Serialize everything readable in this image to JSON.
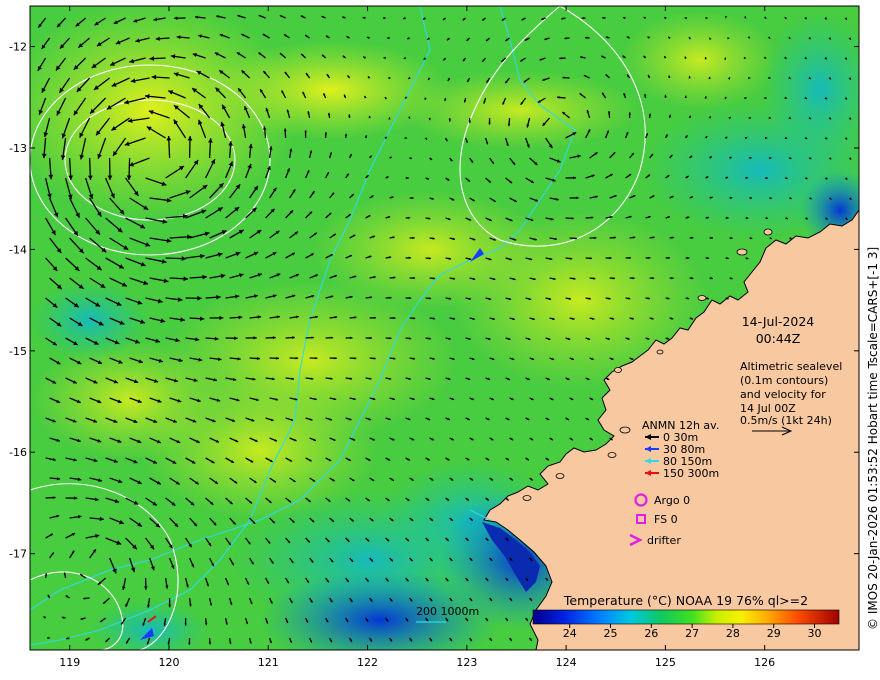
{
  "map": {
    "lon_range": [
      118.6,
      126.95
    ],
    "lat_range": [
      -17.95,
      -11.6
    ],
    "lon_ticks": [
      "119",
      "120",
      "121",
      "122",
      "123",
      "124",
      "125",
      "126"
    ],
    "lat_ticks": [
      "-12",
      "-13",
      "-14",
      "-15",
      "-16",
      "-17"
    ],
    "colors": {
      "land": "#f8c8a0",
      "coast": "#000000",
      "sealevel_contour": "#ffffff",
      "isobath": "#30d8e8"
    }
  },
  "annotations": {
    "date": "14-Jul-2024",
    "time": "00:44Z",
    "alt_lines": [
      "Altimetric sealevel",
      "(0.1m contours)",
      "and velocity for",
      "14 Jul 00Z",
      "0.5m/s (1kt 24h)"
    ],
    "side_text": "© IMOS 20-Jan-2026 01:53:52 Hobart time Tscale=CARS+[-1 3]"
  },
  "legend": {
    "title": "ANMN 12h av.",
    "items": [
      {
        "label": "0 30m",
        "color": "#000000"
      },
      {
        "label": "30 80m",
        "color": "#1a3cff"
      },
      {
        "label": "80 150m",
        "color": "#30d8e8"
      },
      {
        "label": "150 300m",
        "color": "#e81010"
      }
    ],
    "argo": "Argo 0",
    "fs": "FS 0",
    "drifter": "drifter",
    "marker_color": "#e020e0",
    "isobath_label": "200  1000m"
  },
  "colorbar": {
    "title": "Temperature (°C) NOAA 19 76% ql>=2",
    "ticks": [
      "24",
      "25",
      "26",
      "27",
      "28",
      "29",
      "30"
    ],
    "range": [
      23.1,
      30.6
    ]
  }
}
